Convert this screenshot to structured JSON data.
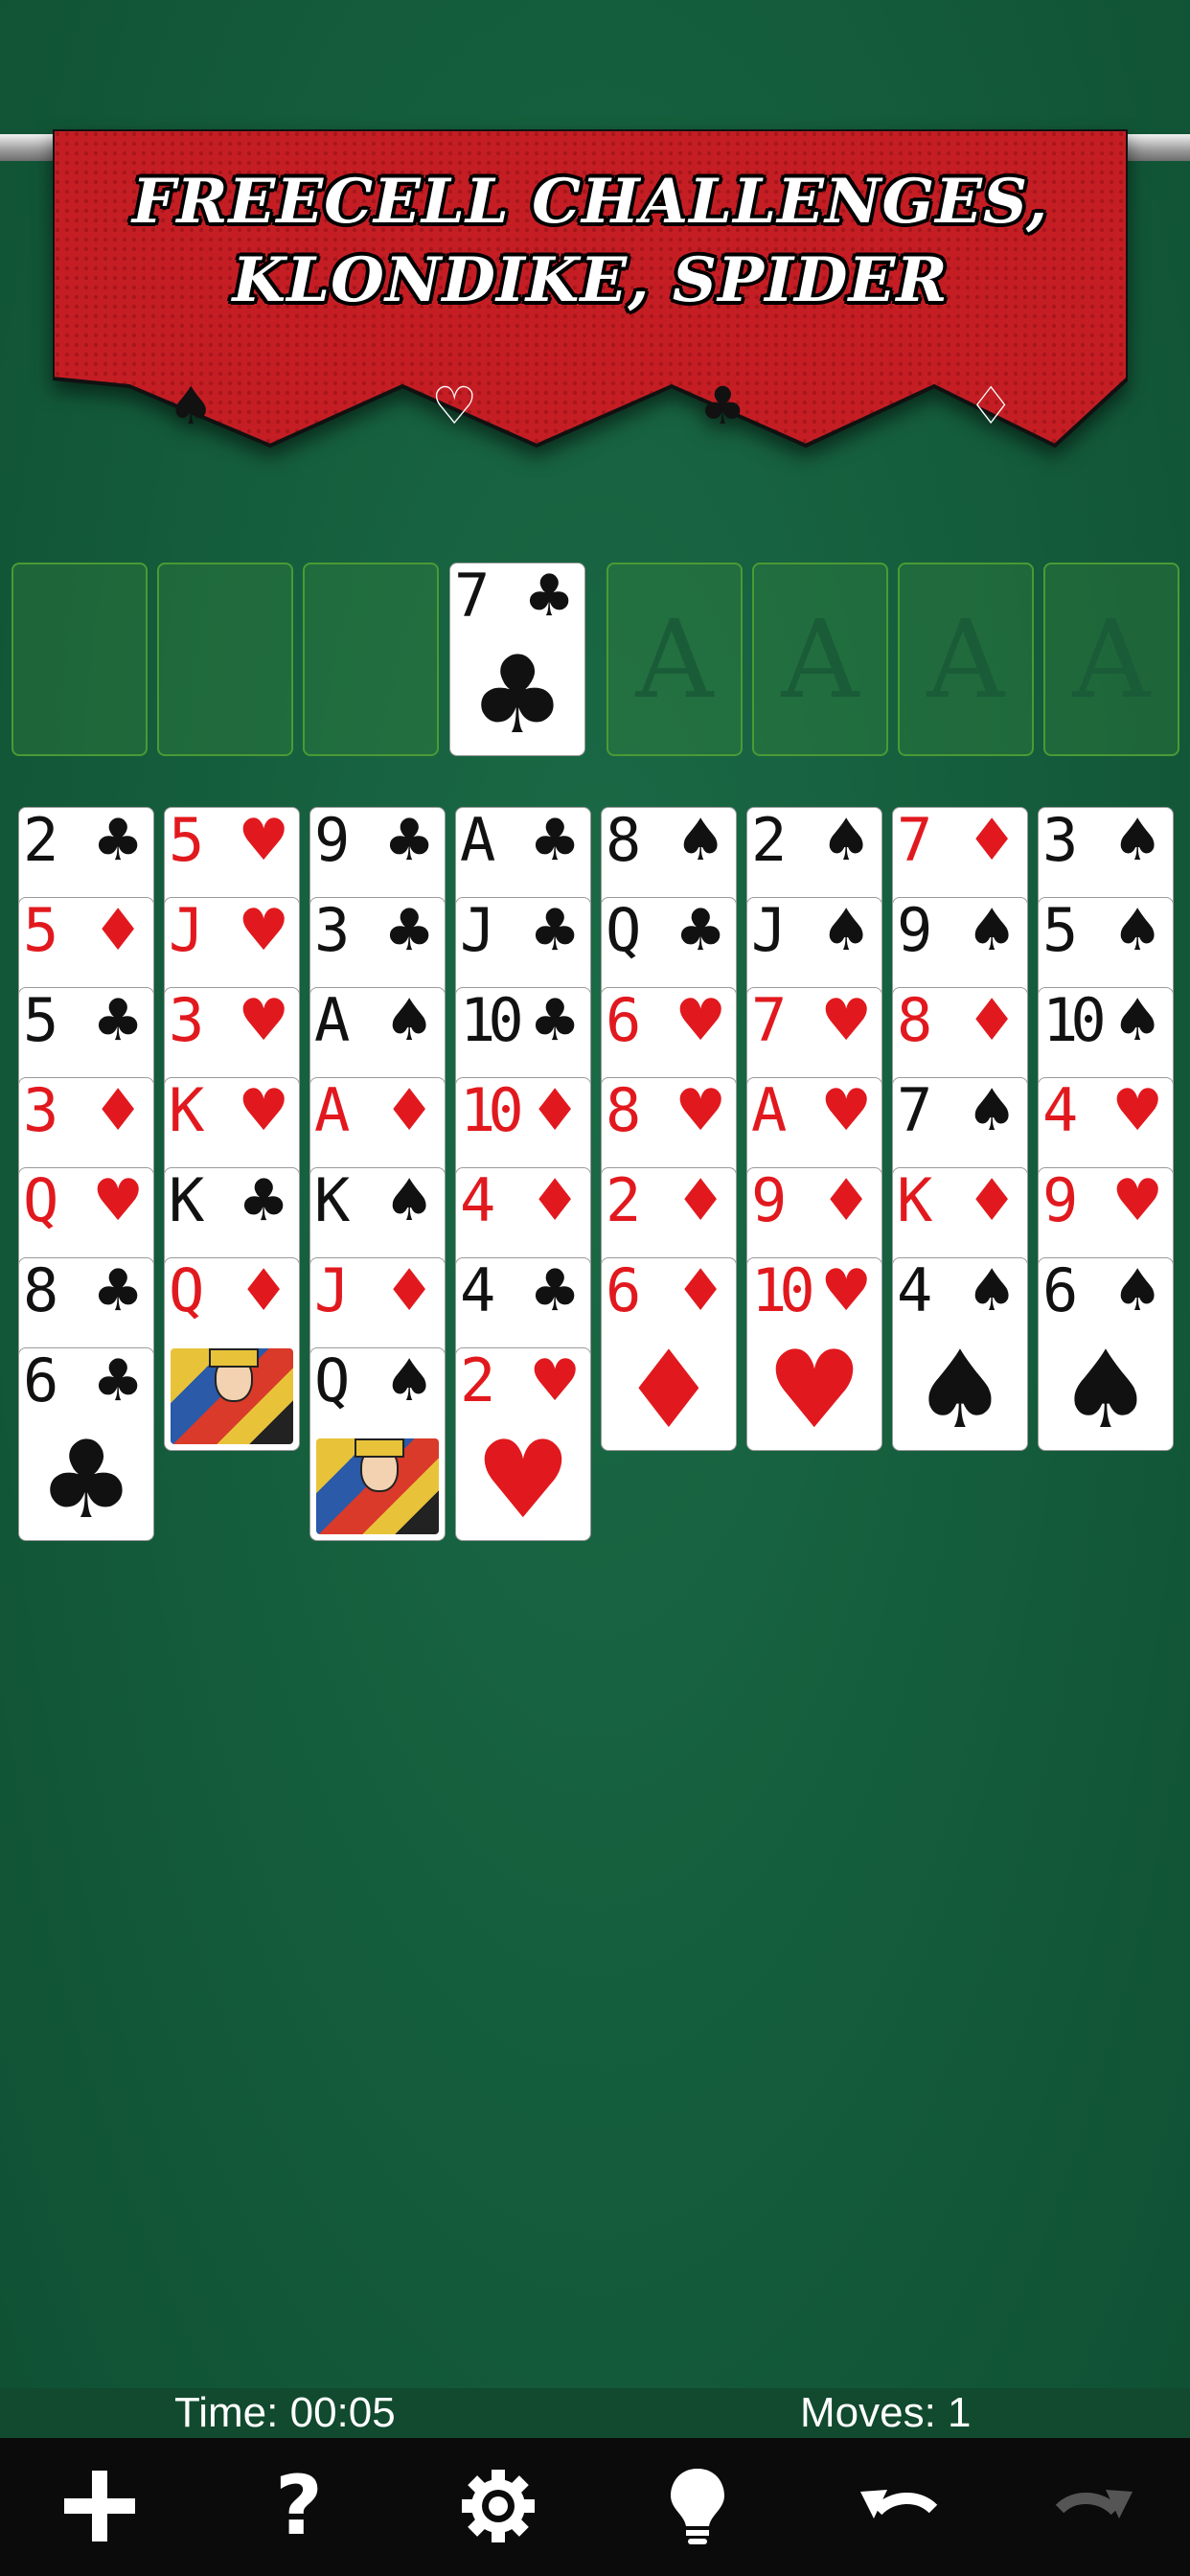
{
  "banner": {
    "line1": "FREECELL CHALLENGES,",
    "line2": "KLONDIKE, SPIDER",
    "suits": [
      "spade-icon",
      "heart-icon",
      "club-icon",
      "diamond-icon"
    ]
  },
  "free_cells": [
    "",
    "",
    "",
    {
      "rank": "7",
      "suit": "club"
    }
  ],
  "foundations": [
    "A",
    "A",
    "A",
    "A"
  ],
  "tableau": [
    [
      [
        "2",
        "club"
      ],
      [
        "5",
        "diamond"
      ],
      [
        "5",
        "club"
      ],
      [
        "3",
        "diamond"
      ],
      [
        "Q",
        "heart"
      ],
      [
        "8",
        "club"
      ],
      [
        "6",
        "club"
      ]
    ],
    [
      [
        "5",
        "heart"
      ],
      [
        "J",
        "heart"
      ],
      [
        "3",
        "heart"
      ],
      [
        "K",
        "heart"
      ],
      [
        "K",
        "club"
      ],
      [
        "Q",
        "diamond"
      ]
    ],
    [
      [
        "9",
        "club"
      ],
      [
        "3",
        "club"
      ],
      [
        "A",
        "spade"
      ],
      [
        "A",
        "diamond"
      ],
      [
        "K",
        "spade"
      ],
      [
        "J",
        "diamond"
      ],
      [
        "Q",
        "spade"
      ]
    ],
    [
      [
        "A",
        "club"
      ],
      [
        "J",
        "club"
      ],
      [
        "10",
        "club"
      ],
      [
        "10",
        "diamond"
      ],
      [
        "4",
        "diamond"
      ],
      [
        "4",
        "club"
      ],
      [
        "2",
        "heart"
      ]
    ],
    [
      [
        "8",
        "spade"
      ],
      [
        "Q",
        "club"
      ],
      [
        "6",
        "heart"
      ],
      [
        "8",
        "heart"
      ],
      [
        "2",
        "diamond"
      ],
      [
        "6",
        "diamond"
      ]
    ],
    [
      [
        "2",
        "spade"
      ],
      [
        "J",
        "spade"
      ],
      [
        "7",
        "heart"
      ],
      [
        "A",
        "heart"
      ],
      [
        "9",
        "diamond"
      ],
      [
        "10",
        "heart"
      ]
    ],
    [
      [
        "7",
        "diamond"
      ],
      [
        "9",
        "spade"
      ],
      [
        "8",
        "diamond"
      ],
      [
        "7",
        "spade"
      ],
      [
        "K",
        "diamond"
      ],
      [
        "4",
        "spade"
      ]
    ],
    [
      [
        "3",
        "spade"
      ],
      [
        "5",
        "spade"
      ],
      [
        "10",
        "spade"
      ],
      [
        "4",
        "heart"
      ],
      [
        "9",
        "heart"
      ],
      [
        "6",
        "spade"
      ]
    ]
  ],
  "status": {
    "time": "Time: 00:05",
    "moves": "Moves: 1"
  },
  "toolbar": [
    "new-game-icon",
    "help-icon",
    "settings-icon",
    "hint-icon",
    "undo-icon",
    "redo-icon"
  ],
  "colors": {
    "felt": "#135a3a",
    "banner": "#c41e24",
    "red_suit": "#e1191e"
  }
}
